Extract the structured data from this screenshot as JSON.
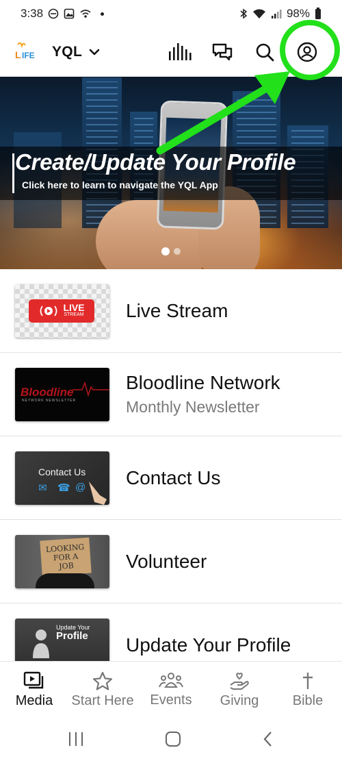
{
  "status_bar": {
    "time": "3:38",
    "battery": "98%"
  },
  "header": {
    "app_name": "YQL",
    "logo_text": "LIFE"
  },
  "banner": {
    "title": "Create/Update Your Profile",
    "subtitle": "Click here to learn to navigate the YQL App",
    "slides": 2,
    "active_slide": 1
  },
  "list": {
    "items": [
      {
        "title": "Live Stream",
        "subtitle": "",
        "thumb": {
          "line1": "LIVE",
          "line2": "STREAM"
        }
      },
      {
        "title": "Bloodline Network",
        "subtitle": "Monthly Newsletter",
        "thumb": {
          "line1": "Bloodline",
          "line2": "NETWORK NEWSLETTER"
        }
      },
      {
        "title": "Contact Us",
        "subtitle": "",
        "thumb": {
          "line1": "Contact Us"
        }
      },
      {
        "title": "Volunteer",
        "subtitle": "",
        "thumb": {
          "line1": "LOOKING",
          "line2": "FOR A",
          "line3": "JOB"
        }
      },
      {
        "title": "Update Your Profile",
        "subtitle": "",
        "thumb": {
          "line1": "Update Your",
          "line2": "Profile"
        }
      }
    ]
  },
  "bottom_nav": {
    "items": [
      {
        "label": "Media",
        "icon": "media-icon",
        "active": true
      },
      {
        "label": "Start Here",
        "icon": "star-icon",
        "active": false
      },
      {
        "label": "Events",
        "icon": "people-icon",
        "active": false
      },
      {
        "label": "Giving",
        "icon": "giving-hand-icon",
        "active": false
      },
      {
        "label": "Bible",
        "icon": "cross-icon",
        "active": false
      }
    ]
  },
  "colors": {
    "annotation_green": "#22e01a",
    "live_red": "#e22a2a",
    "bloodline_red": "#b4151b",
    "inactive_nav": "#777777"
  }
}
